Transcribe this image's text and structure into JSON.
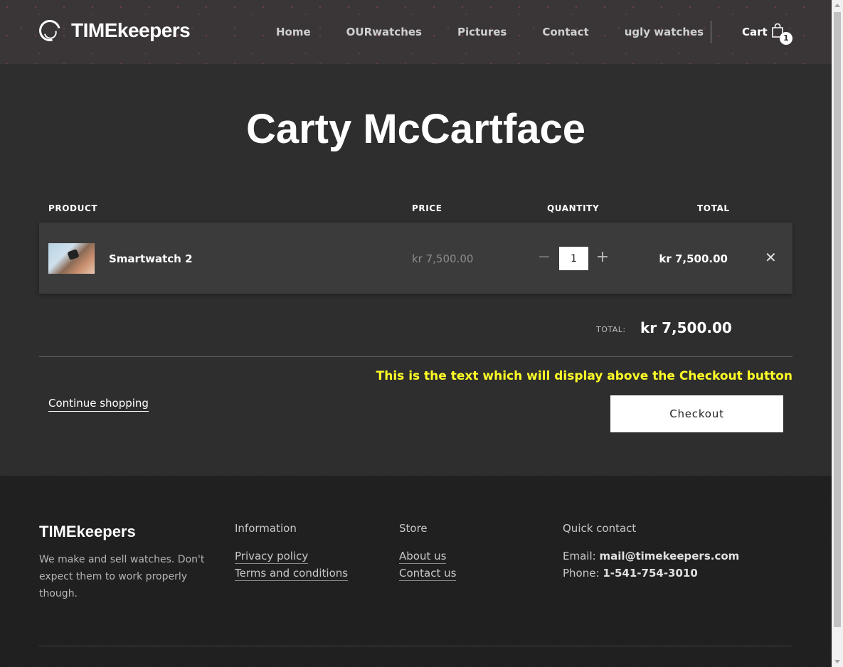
{
  "header": {
    "brand": "TIMEkeepers",
    "nav": [
      "Home",
      "OURwatches",
      "Pictures",
      "Contact",
      "ugly watches"
    ],
    "cart_label": "Cart",
    "cart_count": "1"
  },
  "page": {
    "title": "Carty McCartface"
  },
  "table": {
    "headers": {
      "product": "PRODUCT",
      "price": "PRICE",
      "quantity": "QUANTITY",
      "total": "TOTAL"
    },
    "rows": [
      {
        "name": "Smartwatch 2",
        "price": "kr 7,500.00",
        "quantity": "1",
        "total": "kr 7,500.00",
        "thumbnail": "smartwatch-photo"
      }
    ]
  },
  "summary": {
    "total_label": "TOTAL:",
    "total_value": "kr 7,500.00",
    "checkout_note": "This is the text which will display above the Checkout button",
    "continue_label": "Continue shopping",
    "checkout_label": "Checkout"
  },
  "footer": {
    "brand": "TIMEkeepers",
    "description": "We make and sell watches. Don't expect them to work properly though.",
    "information": {
      "heading": "Information",
      "links": [
        "Privacy policy",
        "Terms and conditions"
      ]
    },
    "store": {
      "heading": "Store",
      "links": [
        "About us",
        "Contact us"
      ]
    },
    "contact": {
      "heading": "Quick contact",
      "email_label": "Email:",
      "email": "mail@timekeepers.com",
      "phone_label": "Phone:",
      "phone": "1-541-754-3010"
    }
  },
  "colors": {
    "accent_note": "#ffff27",
    "background": "#2e2e2e",
    "footer": "#1e1e1e"
  }
}
